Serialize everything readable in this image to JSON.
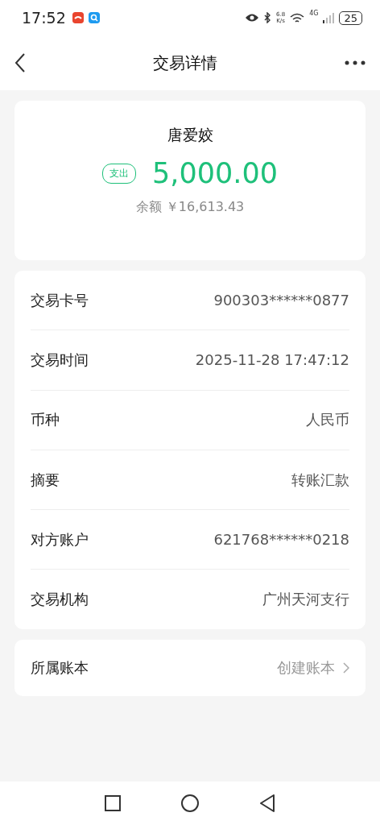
{
  "status_bar": {
    "time": "17:52",
    "speed_value": "6.8",
    "speed_unit": "K/s",
    "network": "4G",
    "battery": "25"
  },
  "header": {
    "title": "交易详情"
  },
  "summary": {
    "name": "唐爱姣",
    "type_badge": "支出",
    "amount": "5,000.00",
    "balance_label": "余额",
    "balance": "￥16,613.43"
  },
  "details": [
    {
      "label": "交易卡号",
      "value": "900303******0877"
    },
    {
      "label": "交易时间",
      "value": "2025-11-28 17:47:12"
    },
    {
      "label": "币种",
      "value": "人民币"
    },
    {
      "label": "摘要",
      "value": "转账汇款"
    },
    {
      "label": "对方账户",
      "value": "621768******0218"
    },
    {
      "label": "交易机构",
      "value": "广州天河支行"
    }
  ],
  "ledger": {
    "label": "所属账本",
    "action": "创建账本"
  }
}
